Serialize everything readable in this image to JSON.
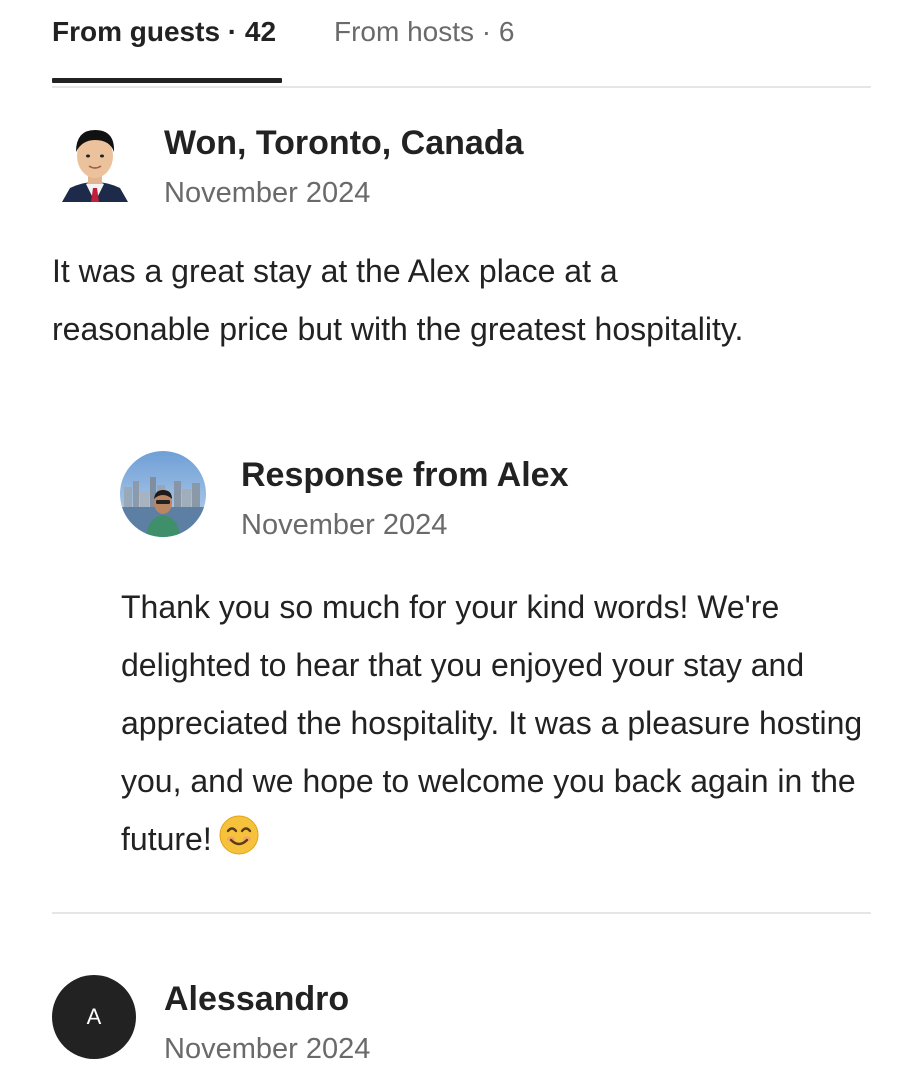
{
  "tabs": {
    "guests_label": "From guests · 42",
    "hosts_label": "From hosts · 6"
  },
  "reviews": [
    {
      "reviewer": "Won, Toronto, Canada",
      "date": "November 2024",
      "text": "It was a great stay at the Alex place at a reasonable price but with the greatest hospitality.",
      "response": {
        "title": "Response from Alex",
        "date": "November 2024",
        "text": "Thank you so much for your kind words! We're delighted to hear that you enjoyed your stay and appreciated the hospitality. It was a pleasure hosting you, and we hope to welcome you back again in the future!",
        "emoji": "smiling-face-icon"
      }
    },
    {
      "reviewer": "Alessandro",
      "avatar_letter": "A",
      "date": "November 2024"
    }
  ],
  "colors": {
    "primary_text": "#222222",
    "secondary_text": "#6a6a6a",
    "divider": "#e6e6e6"
  }
}
